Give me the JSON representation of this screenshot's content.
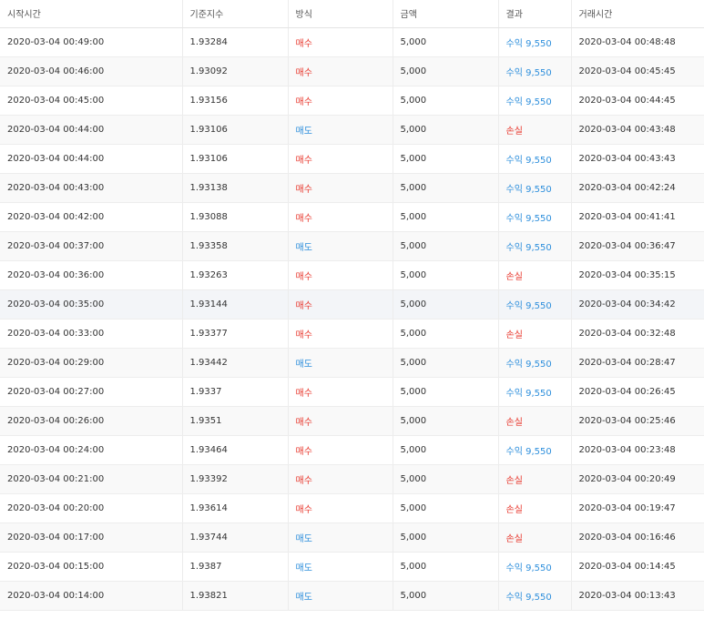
{
  "colors": {
    "buy": "#e8392f",
    "sell": "#2e8fdc",
    "profit": "#2e8fdc",
    "loss": "#e8392f"
  },
  "headers": [
    "시작시간",
    "기준지수",
    "방식",
    "금액",
    "결과",
    "거래시간"
  ],
  "rows": [
    {
      "start": "2020-03-04 00:49:00",
      "index": "1.93284",
      "type": "매수",
      "amount": "5,000",
      "result": "수익 9,550",
      "trade": "2020-03-04 00:48:48"
    },
    {
      "start": "2020-03-04 00:46:00",
      "index": "1.93092",
      "type": "매수",
      "amount": "5,000",
      "result": "수익 9,550",
      "trade": "2020-03-04 00:45:45"
    },
    {
      "start": "2020-03-04 00:45:00",
      "index": "1.93156",
      "type": "매수",
      "amount": "5,000",
      "result": "수익 9,550",
      "trade": "2020-03-04 00:44:45"
    },
    {
      "start": "2020-03-04 00:44:00",
      "index": "1.93106",
      "type": "매도",
      "amount": "5,000",
      "result": "손실",
      "trade": "2020-03-04 00:43:48"
    },
    {
      "start": "2020-03-04 00:44:00",
      "index": "1.93106",
      "type": "매수",
      "amount": "5,000",
      "result": "수익 9,550",
      "trade": "2020-03-04 00:43:43"
    },
    {
      "start": "2020-03-04 00:43:00",
      "index": "1.93138",
      "type": "매수",
      "amount": "5,000",
      "result": "수익 9,550",
      "trade": "2020-03-04 00:42:24"
    },
    {
      "start": "2020-03-04 00:42:00",
      "index": "1.93088",
      "type": "매수",
      "amount": "5,000",
      "result": "수익 9,550",
      "trade": "2020-03-04 00:41:41"
    },
    {
      "start": "2020-03-04 00:37:00",
      "index": "1.93358",
      "type": "매도",
      "amount": "5,000",
      "result": "수익 9,550",
      "trade": "2020-03-04 00:36:47"
    },
    {
      "start": "2020-03-04 00:36:00",
      "index": "1.93263",
      "type": "매수",
      "amount": "5,000",
      "result": "손실",
      "trade": "2020-03-04 00:35:15"
    },
    {
      "start": "2020-03-04 00:35:00",
      "index": "1.93144",
      "type": "매수",
      "amount": "5,000",
      "result": "수익 9,550",
      "trade": "2020-03-04 00:34:42"
    },
    {
      "start": "2020-03-04 00:33:00",
      "index": "1.93377",
      "type": "매수",
      "amount": "5,000",
      "result": "손실",
      "trade": "2020-03-04 00:32:48"
    },
    {
      "start": "2020-03-04 00:29:00",
      "index": "1.93442",
      "type": "매도",
      "amount": "5,000",
      "result": "수익 9,550",
      "trade": "2020-03-04 00:28:47"
    },
    {
      "start": "2020-03-04 00:27:00",
      "index": "1.9337",
      "type": "매수",
      "amount": "5,000",
      "result": "수익 9,550",
      "trade": "2020-03-04 00:26:45"
    },
    {
      "start": "2020-03-04 00:26:00",
      "index": "1.9351",
      "type": "매수",
      "amount": "5,000",
      "result": "손실",
      "trade": "2020-03-04 00:25:46"
    },
    {
      "start": "2020-03-04 00:24:00",
      "index": "1.93464",
      "type": "매수",
      "amount": "5,000",
      "result": "수익 9,550",
      "trade": "2020-03-04 00:23:48"
    },
    {
      "start": "2020-03-04 00:21:00",
      "index": "1.93392",
      "type": "매수",
      "amount": "5,000",
      "result": "손실",
      "trade": "2020-03-04 00:20:49"
    },
    {
      "start": "2020-03-04 00:20:00",
      "index": "1.93614",
      "type": "매수",
      "amount": "5,000",
      "result": "손실",
      "trade": "2020-03-04 00:19:47"
    },
    {
      "start": "2020-03-04 00:17:00",
      "index": "1.93744",
      "type": "매도",
      "amount": "5,000",
      "result": "손실",
      "trade": "2020-03-04 00:16:46"
    },
    {
      "start": "2020-03-04 00:15:00",
      "index": "1.9387",
      "type": "매도",
      "amount": "5,000",
      "result": "수익 9,550",
      "trade": "2020-03-04 00:14:45"
    },
    {
      "start": "2020-03-04 00:14:00",
      "index": "1.93821",
      "type": "매도",
      "amount": "5,000",
      "result": "수익 9,550",
      "trade": "2020-03-04 00:13:43"
    }
  ]
}
